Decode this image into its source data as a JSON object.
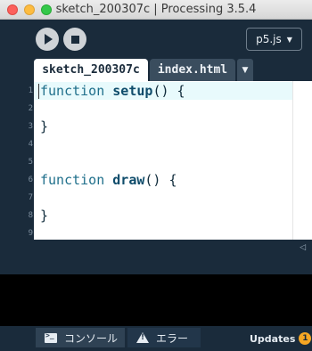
{
  "window": {
    "title": "sketch_200307c | Processing 3.5.4"
  },
  "toolbar": {
    "run_icon": "play-icon",
    "stop_icon": "stop-icon",
    "mode_label": "p5.js",
    "mode_caret": "▼"
  },
  "tabs": [
    {
      "label": "sketch_200307c",
      "active": true
    },
    {
      "label": "index.html",
      "active": false
    }
  ],
  "tab_menu_caret": "▼",
  "editor": {
    "line_numbers": [
      "1",
      "2",
      "3",
      "4",
      "5",
      "6",
      "7",
      "8",
      "9"
    ],
    "lines": [
      {
        "keyword": "function",
        "name": "setup",
        "rest": "() {"
      },
      {
        "text": ""
      },
      {
        "text": "}"
      },
      {
        "text": ""
      },
      {
        "text": ""
      },
      {
        "keyword": "function",
        "name": "draw",
        "rest": "() {"
      },
      {
        "text": ""
      },
      {
        "text": "}"
      }
    ]
  },
  "divider": {
    "collapse_arrow": "◁"
  },
  "footer": {
    "console_label": "コンソール",
    "error_label": "エラー",
    "updates_label": "Updates",
    "updates_count": "1"
  },
  "colors": {
    "background": "#1a2b3b",
    "accent_badge": "#f5a623",
    "keyword": "#1f6f8b",
    "current_line": "#e8fafc"
  }
}
